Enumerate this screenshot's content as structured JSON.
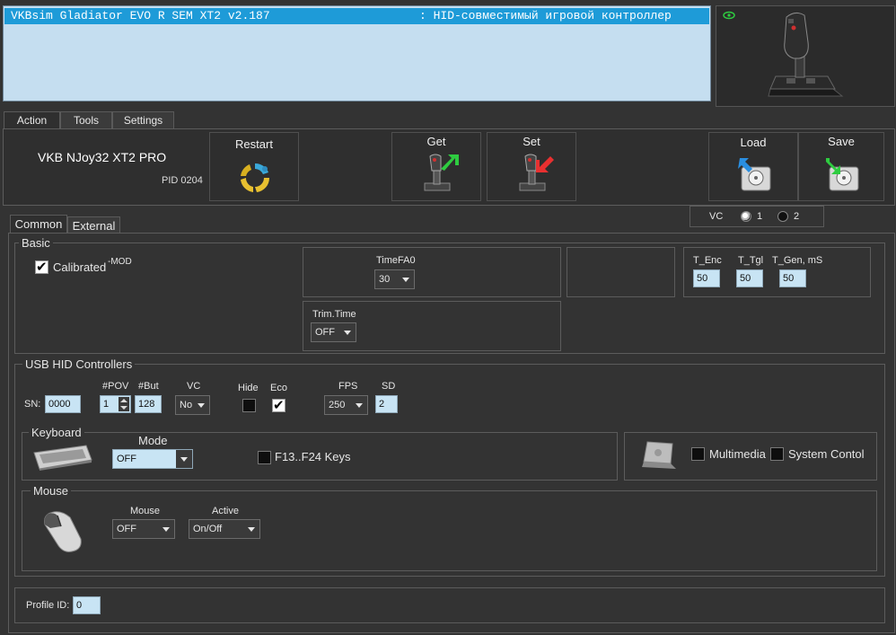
{
  "device_list": {
    "rows": [
      {
        "name": "VKBsim Gladiator EVO R SEM XT2 v2.187",
        "desc": ": HID-совместимый игровой контроллер"
      }
    ]
  },
  "tabs": [
    {
      "label": "Action",
      "active": true
    },
    {
      "label": "Tools",
      "active": false
    },
    {
      "label": "Settings",
      "active": false
    }
  ],
  "toolbar": {
    "device_model": "VKB NJoy32 XT2 PRO",
    "pid": "PID 0204",
    "restart": "Restart",
    "get": "Get",
    "set": "Set",
    "load": "Load",
    "save": "Save"
  },
  "subtabs": [
    {
      "label": "Common",
      "active": true
    },
    {
      "label": "External",
      "active": false
    }
  ],
  "vc_selector": {
    "label": "VC",
    "options": [
      "1",
      "2"
    ],
    "selected": "1"
  },
  "basic": {
    "title": "Basic",
    "calibrated_label": "Calibrated",
    "calibrated_sup": "-MOD",
    "calibrated_checked": true,
    "timefa0_label": "TimeFA0",
    "timefa0_value": "30",
    "trim_time_label": "Trim.Time",
    "trim_time_value": "OFF",
    "t_enc_label": "T_Enc",
    "t_enc_value": "50",
    "t_tgl_label": "T_Tgl",
    "t_tgl_value": "50",
    "t_gen_label": "T_Gen, mS",
    "t_gen_value": "50"
  },
  "usb": {
    "title": "USB HID Controllers",
    "sn_label": "SN:",
    "sn_value": "0000",
    "pov_label": "#POV",
    "pov_value": "1",
    "but_label": "#But",
    "but_value": "128",
    "vc_label": "VC",
    "vc_value": "No",
    "hide_label": "Hide",
    "hide_checked": false,
    "eco_label": "Eco",
    "eco_checked": true,
    "fps_label": "FPS",
    "fps_value": "250",
    "sd_label": "SD",
    "sd_value": "2"
  },
  "keyboard": {
    "title": "Keyboard",
    "mode_label": "Mode",
    "mode_value": "OFF",
    "f13_label": "F13..F24 Keys",
    "f13_checked": false
  },
  "media": {
    "multimedia_label": "Multimedia",
    "multimedia_checked": false,
    "system_label": "System Contol",
    "system_checked": false
  },
  "mouse": {
    "title": "Mouse",
    "mouse_label": "Mouse",
    "mouse_value": "OFF",
    "active_label": "Active",
    "active_value": "On/Off"
  },
  "profile": {
    "label": "Profile ID:",
    "value": "0"
  },
  "colors": {
    "background": "#333333",
    "list_bg": "#c5def0",
    "list_selected": "#1e9bd8",
    "field_bg": "#c8e4f4"
  }
}
